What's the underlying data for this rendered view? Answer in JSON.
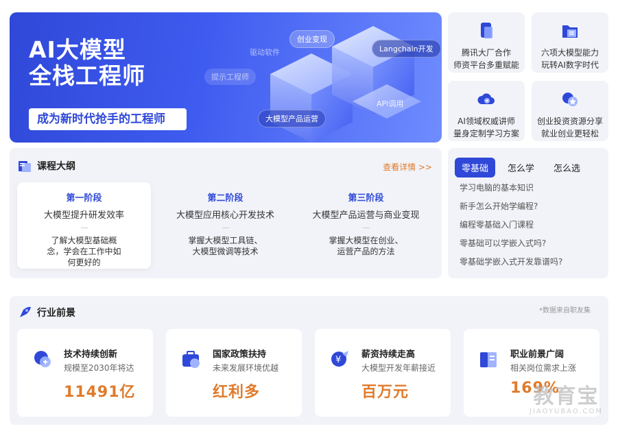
{
  "banner": {
    "title": "AI大模型\n全栈工程师",
    "subtitle": "成为新时代抢手的工程师",
    "tags": {
      "drive_software": "驱动软件",
      "startup_monetize": "创业变现",
      "langchain": "Langchain开发",
      "prompt_engineer": "提示工程师",
      "api_call": "API调用",
      "product_ops": "大模型产品运营"
    }
  },
  "features": [
    {
      "icon": "tablet-icon",
      "line1": "腾讯大厂合作",
      "line2": "师资平台多重赋能"
    },
    {
      "icon": "folder-icon",
      "line1": "六项大模型能力",
      "line2": "玩转AI数字时代"
    },
    {
      "icon": "cloud-gear-icon",
      "line1": "AI领域权威讲师",
      "line2": "量身定制学习方案"
    },
    {
      "icon": "shield-star-icon",
      "line1": "创业投资资源分享",
      "line2": "就业创业更轻松"
    }
  ],
  "outline": {
    "title": "课程大纲",
    "more": "查看详情 >>",
    "stages": [
      {
        "name": "第一阶段",
        "goal": "大模型提升研发效率",
        "desc": "了解大模型基础概念，学会在工作中如何更好的"
      },
      {
        "name": "第二阶段",
        "goal": "大模型应用核心开发技术",
        "desc": "掌握大模型工具链、大模型微调等技术"
      },
      {
        "name": "第三阶段",
        "goal": "大模型产品运营与商业变现",
        "desc": "掌握大模型在创业、运营产品的方法"
      }
    ]
  },
  "faq": {
    "tabs": [
      "零基础",
      "怎么学",
      "怎么选"
    ],
    "items": [
      "学习电脑的基本知识",
      "新手怎么开始学编程?",
      "编程零基础入门课程",
      "零基础可以学嵌入式吗?",
      "零基础学嵌入式开发靠谱吗?"
    ]
  },
  "outlook": {
    "title": "行业前景",
    "note": "*数据来自职友集",
    "cards": [
      {
        "icon": "bulb-icon",
        "title": "技术持续创新",
        "sub": "规模至2030年将达",
        "value": "11491亿"
      },
      {
        "icon": "briefcase-icon",
        "title": "国家政策扶持",
        "sub": "未来发展环境优越",
        "value": "红利多"
      },
      {
        "icon": "money-icon",
        "title": "薪资持续走高",
        "sub": "大模型开发年薪接近",
        "value": "百万元"
      },
      {
        "icon": "grid-icon",
        "title": "职业前景广阔",
        "sub": "相关岗位需求上涨",
        "value": "169%"
      }
    ]
  },
  "watermark": {
    "cn": "教育宝",
    "en": "JIAOYUBAO.COM"
  }
}
